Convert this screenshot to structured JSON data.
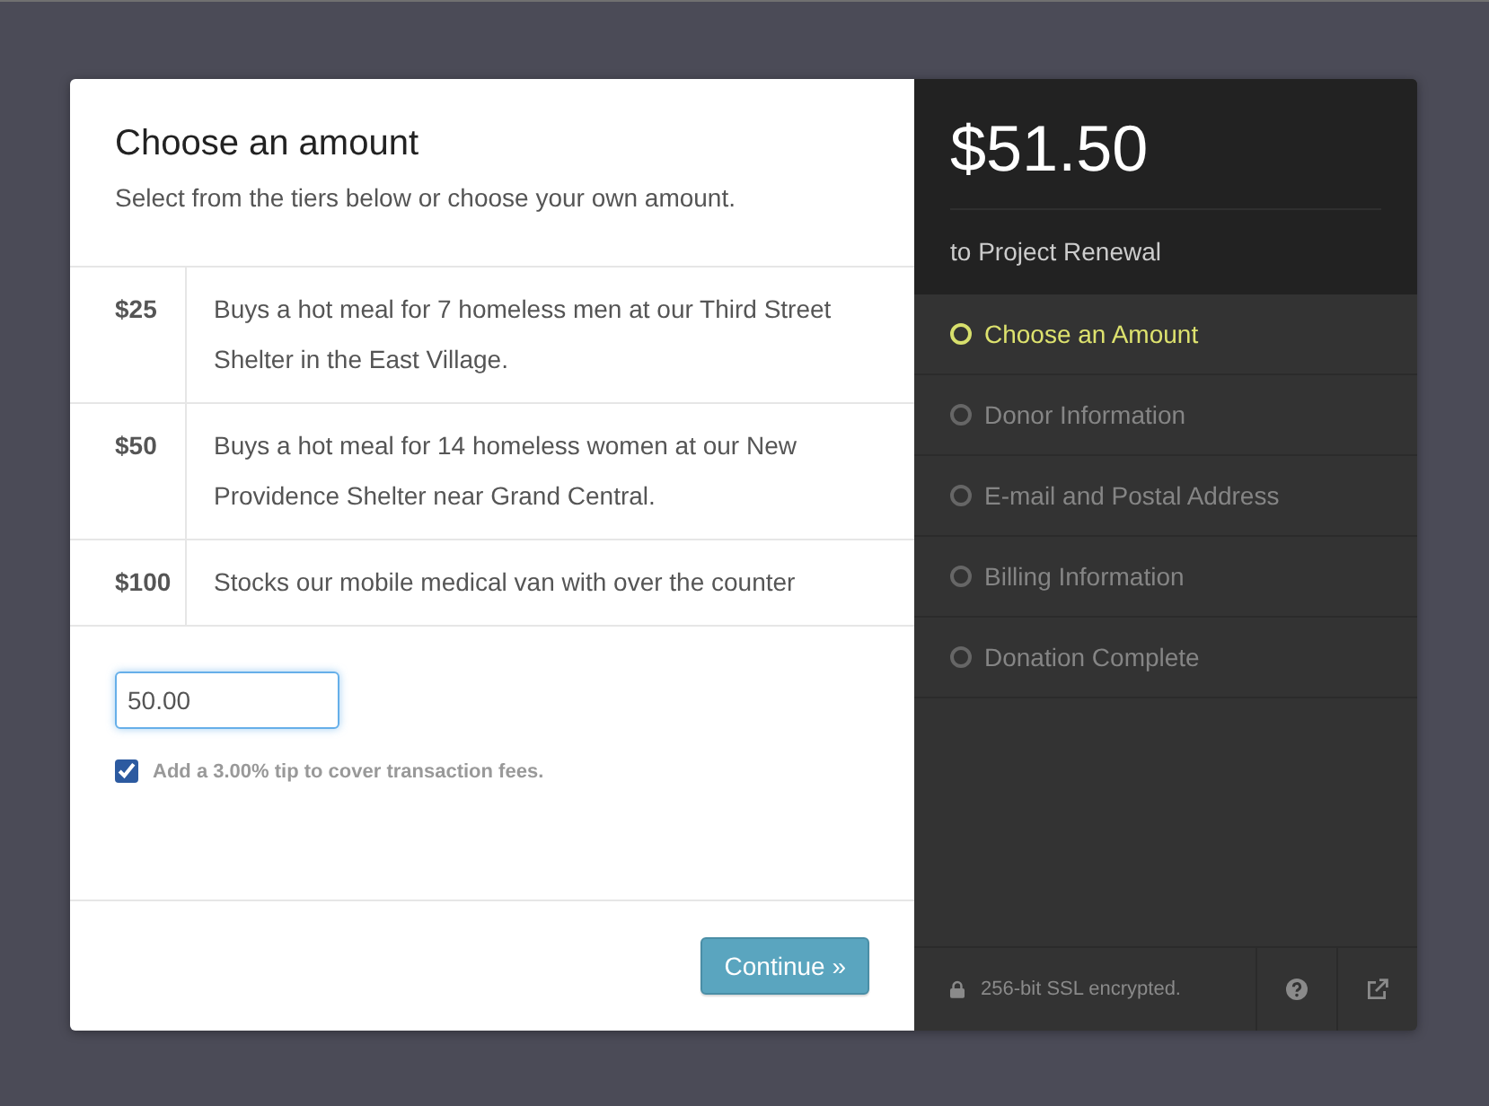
{
  "form": {
    "title": "Choose an amount",
    "subtitle": "Select from the tiers below or choose your own amount.",
    "tiers": [
      {
        "amount": "$25",
        "description": "Buys a hot meal for 7 homeless men at our Third Street Shelter in the East Village."
      },
      {
        "amount": "$50",
        "description": "Buys a hot meal for 14 homeless women at our New Providence Shelter near Grand Central."
      },
      {
        "amount": "$100",
        "description": "Stocks our mobile medical van with over the counter"
      }
    ],
    "amount_field": {
      "value": "50.00",
      "focused": true
    },
    "tip": {
      "checked": true,
      "label": "Add a 3.00% tip to cover transaction fees."
    },
    "continue_button": "Continue »"
  },
  "summary": {
    "total": "$51.50",
    "recipient": "to Project Renewal"
  },
  "steps": [
    {
      "label": "Choose an Amount",
      "selected": true
    },
    {
      "label": "Donor Information",
      "selected": false
    },
    {
      "label": "E-mail and Postal Address",
      "selected": false
    },
    {
      "label": "Billing Information",
      "selected": false
    },
    {
      "label": "Donation Complete",
      "selected": false
    }
  ],
  "footer": {
    "security_note": "256-bit SSL encrypted."
  }
}
